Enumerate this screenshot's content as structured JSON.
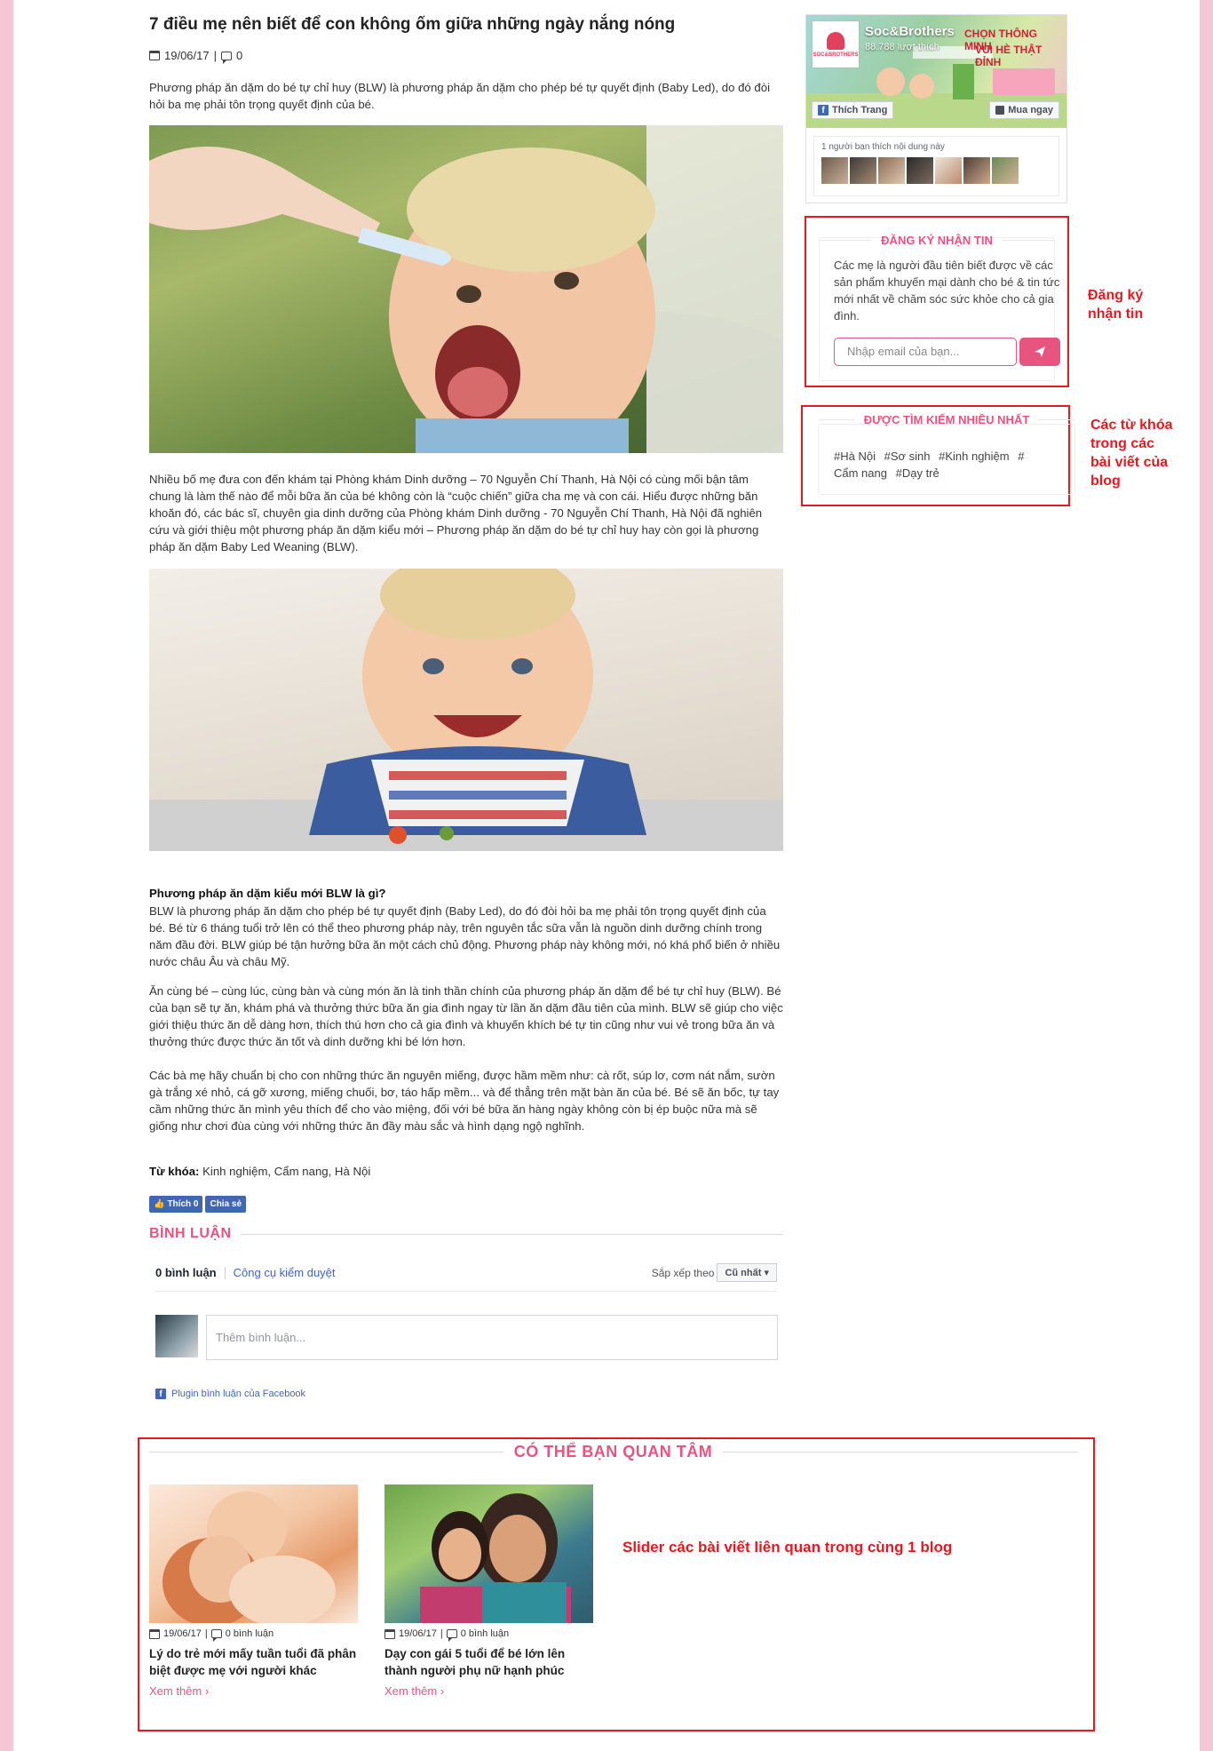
{
  "article": {
    "title": "7 điều mẹ nên biết để con không ốm giữa những ngày nắng nóng",
    "date": "19/06/17",
    "divider": "|",
    "comment_count": "0",
    "intro": "Phương pháp ăn dặm do bé tự chỉ huy (BLW) là phương pháp ăn dặm cho phép bé tự quyết định (Baby Led), do đó đòi hỏi ba mẹ phải tôn trọng quyết định của bé.",
    "para1": "Nhiều bố mẹ đưa con đến khám tại Phòng khám Dinh dưỡng – 70 Nguyễn Chí Thanh, Hà Nội có cùng mối bận tâm chung là làm thế nào để mỗi bữa ăn của bé không còn là “cuộc chiến” giữa cha mẹ và con cái. Hiểu được những băn khoăn đó, các bác sĩ, chuyên gia dinh dưỡng của Phòng khám Dinh dưỡng - 70 Nguyễn Chí Thanh, Hà Nội đã nghiên cứu và giới thiệu một phương pháp ăn dặm kiểu mới – Phương pháp ăn dặm do bé tự chỉ huy hay còn gọi là phương pháp ăn dặm Baby Led Weaning (BLW).",
    "subheading": "Phương pháp ăn dặm kiểu mới BLW là gì?",
    "para2": "BLW là phương pháp ăn dặm cho phép bé tự quyết định (Baby Led), do đó đòi hỏi ba mẹ phải tôn trọng quyết định của bé. Bé từ 6 tháng tuổi trở lên có thể theo phương pháp này, trên nguyên tắc sữa vẫn là nguồn dinh dưỡng chính trong năm đầu đời. BLW giúp bé tận hưởng bữa ăn một cách chủ động. Phương pháp này không mới, nó khá phổ biến ở nhiều nước châu Âu và châu Mỹ.",
    "para3": "Ăn cùng bé – cùng lúc, cùng bàn và cùng món ăn là tinh thần chính của phương pháp ăn dặm để bé tự chỉ huy (BLW). Bé của bạn sẽ tự ăn, khám phá và thưởng thức bữa ăn gia đình ngay từ lần ăn dặm đầu tiên của mình. BLW sẽ giúp cho việc giới thiệu thức ăn dễ dàng hơn, thích thú hơn cho cả gia đình và khuyến khích bé tự tin cũng như vui vẻ trong bữa ăn và thưởng thức được thức ăn tốt và dinh dưỡng khi bé lớn hơn.",
    "para4": "Các bà mẹ hãy chuẩn bị cho con những thức ăn nguyên miếng, được hầm mềm như: cà rốt, súp lơ, cơm nát nắm, sườn gà trắng xé nhỏ, cá gỡ xương, miếng chuối, bơ, táo hấp mềm... và để thẳng trên mặt bàn ăn của bé. Bé sẽ ăn bốc, tự tay cầm những thức ăn mình yêu thích để cho vào miệng, đối với bé bữa ăn hàng ngày không còn bị ép buộc nữa mà sẽ giống như chơi đùa cùng với những thức ăn đầy màu sắc và hình dạng ngộ nghĩnh.",
    "tags_label": "Từ khóa:",
    "tags_value": "Kinh nghiệm, Cẩm nang, Hà Nội",
    "like_label": "Thích 0",
    "share_label": "Chia sẻ"
  },
  "comments": {
    "heading": "BÌNH LUẬN",
    "count_label": "0 bình luận",
    "moderation_tool": "Công cụ kiểm duyệt",
    "sort_label": "Sắp xếp theo",
    "sort_value": "Cũ nhất",
    "input_placeholder": "Thêm bình luận...",
    "plugin_label": "Plugin bình luận của Facebook"
  },
  "facebook_page": {
    "name": "Soc&Brothers",
    "likes": "88.788 lượt thích",
    "promo_line1": "CHỌN THÔNG MINH",
    "promo_line2": "VUI HÈ THẬT ĐỈNH",
    "logo_text": "SOC&BROTHERS",
    "like_button": "Thích Trang",
    "buy_button": "Mua ngay",
    "friends_text": "1 người bạn thích nội dung này"
  },
  "newsletter": {
    "heading": "ĐĂNG KÝ NHẬN TIN",
    "text": "Các mẹ là người đầu tiên biết được về các sản phẩm khuyến mại dành cho bé & tin tức mới nhất về chăm sóc sức khỏe cho cả gia đình.",
    "email_placeholder": "Nhập email của bạn...",
    "send_icon": "paper-plane-icon"
  },
  "keywords": {
    "heading": "ĐƯỢC TÌM KIẾM NHIỀU NHẤT",
    "items": [
      "#Hà Nội",
      "#Sơ sinh",
      "#Kinh nghiệm",
      "#",
      "Cẩm nang",
      "#Dạy trẻ"
    ]
  },
  "annotations": {
    "newsletter_note_1": "Đăng ký",
    "newsletter_note_2": "nhận tin",
    "keywords_note_1": "Các từ khóa",
    "keywords_note_2": "trong các",
    "keywords_note_3": "bài viết của",
    "keywords_note_4": "blog",
    "related_note": "Slider các bài viết liên quan trong cùng 1 blog",
    "color": "#e11b22"
  },
  "related": {
    "heading": "CÓ THỂ BẠN QUAN TÂM",
    "items": [
      {
        "date": "19/06/17",
        "divider": "|",
        "comments": "0 bình luận",
        "title": "Lý do trẻ mới mấy tuần tuổi đã phân biệt được mẹ với người khác",
        "more": "Xem thêm ›"
      },
      {
        "date": "19/06/17",
        "divider": "|",
        "comments": "0 bình luận",
        "title": "Dạy con gái 5 tuổi để bé lớn lên thành người phụ nữ hạnh phúc",
        "more": "Xem thêm ›"
      }
    ]
  },
  "colors": {
    "accent_pink": "#e75480",
    "page_background": "#f5c6d3",
    "facebook_blue": "#4267b2"
  }
}
